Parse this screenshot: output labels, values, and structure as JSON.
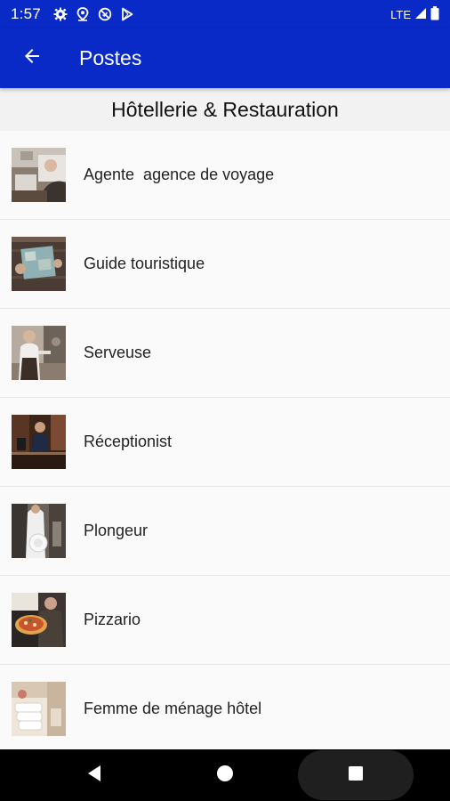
{
  "status_bar": {
    "time": "1:57",
    "network": "LTE",
    "icons": [
      "gear-icon",
      "location-icon",
      "no-disturb-icon",
      "play-store-icon",
      "signal-icon",
      "battery-icon"
    ]
  },
  "app_bar": {
    "title": "Postes",
    "back_icon": "arrow-back-icon"
  },
  "section": {
    "title": "Hôtellerie & Restauration"
  },
  "jobs": [
    {
      "label": "Agente  agence de voyage",
      "image": "travel-agent-photo"
    },
    {
      "label": "Guide touristique",
      "image": "tour-guide-photo"
    },
    {
      "label": "Serveuse",
      "image": "waitress-photo"
    },
    {
      "label": "Réceptionist",
      "image": "receptionist-photo"
    },
    {
      "label": "Plongeur",
      "image": "dishwasher-photo"
    },
    {
      "label": "Pizzario",
      "image": "pizza-maker-photo"
    },
    {
      "label": "Femme de ménage hôtel",
      "image": "housekeeper-photo"
    }
  ],
  "nav_bar": {
    "icons": [
      "back-triangle-icon",
      "home-circle-icon",
      "recents-square-icon"
    ]
  },
  "colors": {
    "primary": "#0a2ac8",
    "background": "#fafafa",
    "header_bg": "#f2f2f2",
    "nav_bg": "#000000"
  }
}
